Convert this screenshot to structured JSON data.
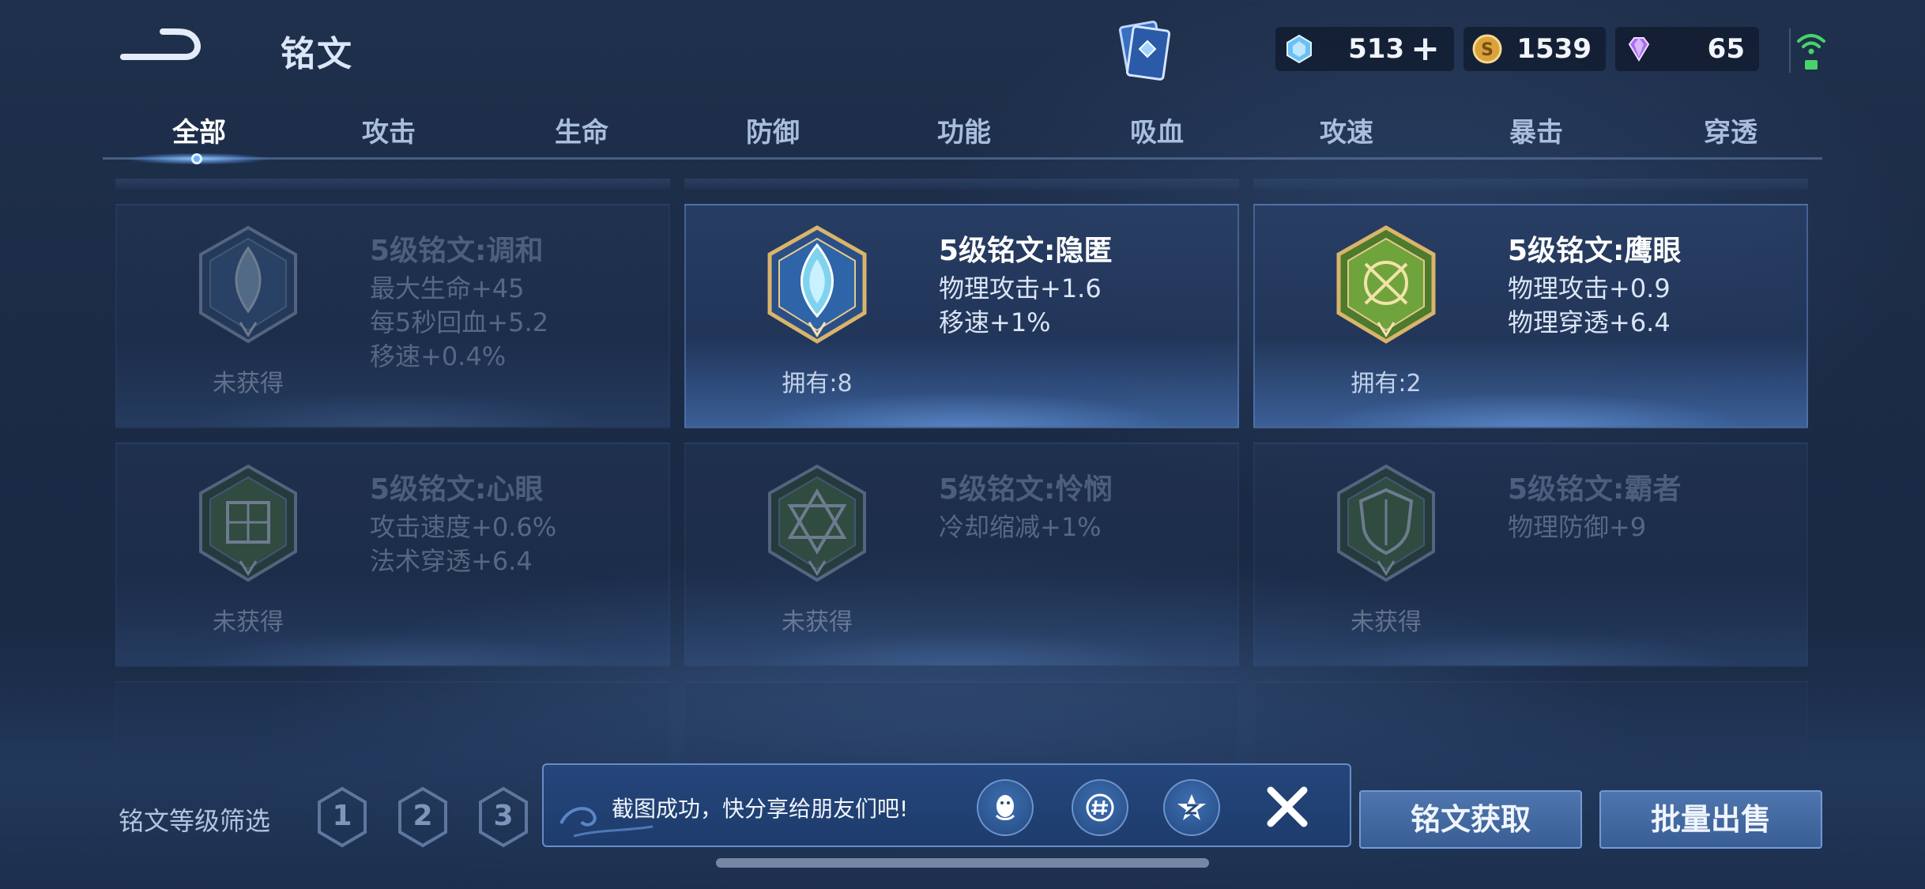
{
  "header": {
    "title": "铭文",
    "back_icon": "back-arrow-icon",
    "event_icon": "rune-book-icon"
  },
  "currencies": [
    {
      "name": "diamond",
      "icon": "crystal-icon",
      "value": "513",
      "has_plus": true,
      "color": "#7cc7ff"
    },
    {
      "name": "gold",
      "icon": "gold-coin-icon",
      "value": "1539",
      "color": "#e6b24a"
    },
    {
      "name": "gem",
      "icon": "purple-gem-icon",
      "value": "65",
      "color": "#b47cff"
    }
  ],
  "tabs": [
    {
      "label": "全部",
      "active": true
    },
    {
      "label": "攻击"
    },
    {
      "label": "生命"
    },
    {
      "label": "防御"
    },
    {
      "label": "功能"
    },
    {
      "label": "吸血"
    },
    {
      "label": "攻速"
    },
    {
      "label": "暴击"
    },
    {
      "label": "穿透"
    }
  ],
  "runes": [
    {
      "name": "5级铭文:调和",
      "stats": [
        "最大生命+45",
        "每5秒回血+5.2",
        "移速+0.4%"
      ],
      "status": "未获得",
      "owned": false,
      "color": "blue"
    },
    {
      "name": "5级铭文:隐匿",
      "stats": [
        "物理攻击+1.6",
        "移速+1%"
      ],
      "status": "拥有:8",
      "owned": true,
      "color": "blue"
    },
    {
      "name": "5级铭文:鹰眼",
      "stats": [
        "物理攻击+0.9",
        "物理穿透+6.4"
      ],
      "status": "拥有:2",
      "owned": true,
      "color": "green"
    },
    {
      "name": "5级铭文:心眼",
      "stats": [
        "攻击速度+0.6%",
        "法术穿透+6.4"
      ],
      "status": "未获得",
      "owned": false,
      "color": "green"
    },
    {
      "name": "5级铭文:怜悯",
      "stats": [
        "冷却缩减+1%"
      ],
      "status": "未获得",
      "owned": false,
      "color": "green"
    },
    {
      "name": "5级铭文:霸者",
      "stats": [
        "物理防御+9"
      ],
      "status": "未获得",
      "owned": false,
      "color": "green"
    }
  ],
  "filter": {
    "label": "铭文等级筛选",
    "levels": [
      "1",
      "2",
      "3"
    ]
  },
  "toast": {
    "message": "截图成功，快分享给朋友们吧!",
    "share_icons": [
      "qq-icon",
      "wechat-moments-icon",
      "qzone-icon"
    ],
    "close_icon": "close-icon"
  },
  "actions": {
    "get_label": "铭文获取",
    "sell_label": "批量出售"
  }
}
